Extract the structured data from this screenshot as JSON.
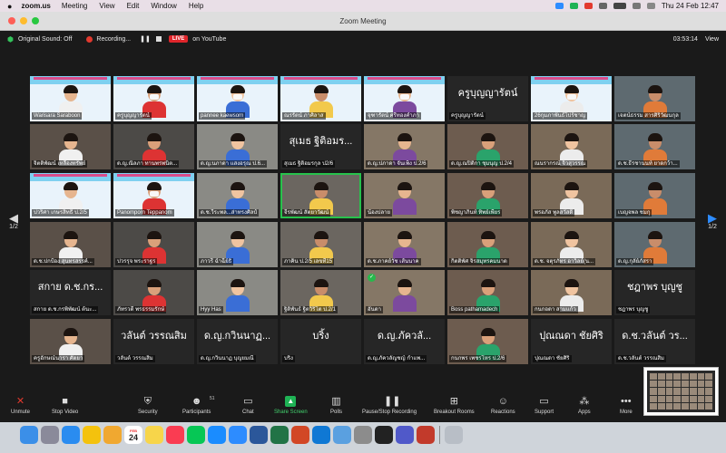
{
  "menubar": {
    "app": "zoom.us",
    "menus": [
      "Meeting",
      "View",
      "Edit",
      "Window",
      "Help"
    ],
    "datetime": "Thu 24 Feb 12:47"
  },
  "window": {
    "title": "Zoom Meeting"
  },
  "topbar": {
    "audio": "Original Sound: Off",
    "recording": "Recording...",
    "live_badge": "LIVE",
    "live_target": "on YouTube",
    "timer": "03:53:14",
    "view": "View"
  },
  "gallery": {
    "page_left": "1/2",
    "page_right": "1/2",
    "tiles": [
      {
        "kind": "banner",
        "label": "Warisara Saraboon",
        "mask": false
      },
      {
        "kind": "banner",
        "label": "ครูบุญญารัตน์",
        "mask": true
      },
      {
        "kind": "banner",
        "label": "pannee kaewsorn",
        "mask": true
      },
      {
        "kind": "banner",
        "label": "ณรรัตน์ ภาศิลาส",
        "mask": false
      },
      {
        "kind": "banner",
        "label": "จุฑารัตน์ ศรีทองคำภา",
        "mask": true
      },
      {
        "kind": "text",
        "big": "ครูบุญญารัตน์",
        "label": "ครูบุญญารัตน์"
      },
      {
        "kind": "banner",
        "label": "26กุมภาพันธ์โปร์ชาญ",
        "mask": true
      },
      {
        "kind": "video",
        "label": "เจตน์ธรรม สารศิริวัฒนกุล"
      },
      {
        "kind": "video",
        "label": "จิตติพัฒน์ เหลืองทรัพย์"
      },
      {
        "kind": "video",
        "label": "ด.ญ.ณิลภา ทานพรพนิต..."
      },
      {
        "kind": "video",
        "label": "ด.ญ.นภาดา แสงอรุณ ป.6..."
      },
      {
        "kind": "text",
        "big": "สุเมธ ฐิติอมร...",
        "label": "สุเมธ ฐิติอมรกุล ป2/6"
      },
      {
        "kind": "video",
        "label": "ด.ญ.ปภาดา จันเพ็ง ป.2/6"
      },
      {
        "kind": "video",
        "label": "ด.ญ.ณปิติกา ชุมนุญ ป.2/4"
      },
      {
        "kind": "video",
        "label": "ณนรากรณ์ จิวสุวรรณ"
      },
      {
        "kind": "video",
        "label": "ด.ช.ธีรชานนท์ ยาดกว้า..."
      },
      {
        "kind": "banner",
        "label": "ปวริศา เกษรสิทธิ์ ป.2/5",
        "mask": false
      },
      {
        "kind": "banner",
        "label": "Panomporn Teppanom",
        "mask": true
      },
      {
        "kind": "video",
        "label": "ด.ช.วีระพล...ส่าทรงศิลป์"
      },
      {
        "kind": "video",
        "label": "จีรพัฒน์ สัตยาวัฒน์",
        "talk": true
      },
      {
        "kind": "video",
        "label": "น้องปลาย"
      },
      {
        "kind": "video",
        "label": "พิชญาภินท์ ทิพย์เพียร"
      },
      {
        "kind": "video",
        "label": "พรอภัส พูลสวัสดิ์"
      },
      {
        "kind": "video",
        "label": "เบญจพล ชมกุ"
      },
      {
        "kind": "video",
        "label": "ด.ช.ปกป้อง สุนทรสรรค์..."
      },
      {
        "kind": "video",
        "label": "ปวรรุจ พระราฐร"
      },
      {
        "kind": "video",
        "label": "ภาวรี ฉำฉีย์ธิ"
      },
      {
        "kind": "video",
        "label": "ภาคิน ป.2/5 เลขที่15"
      },
      {
        "kind": "video",
        "label": "ด.ช.ภาคย์วัช เส้นนาค"
      },
      {
        "kind": "video",
        "label": "กิตติพัศ จิรสมุทรคมนาด"
      },
      {
        "kind": "video",
        "label": "ด.ช. จตุรภัทร อาวิลย์(น..."
      },
      {
        "kind": "video",
        "label": "ด.ญ.กุลัย์ภัสรา"
      },
      {
        "kind": "text",
        "big": "สกาย ด.ช.กร...",
        "label": "สกาย ด.ช.กรพิพัฒน์ ต้นะ..."
      },
      {
        "kind": "video",
        "label": "ภัทรวดี พรธรรมรักษ์"
      },
      {
        "kind": "video",
        "label": "Hyy Has"
      },
      {
        "kind": "video",
        "label": "ฐิติพันธ์ ฐิตวิริโต ป.2/1"
      },
      {
        "kind": "video",
        "label": "อันดา",
        "check": true
      },
      {
        "kind": "video",
        "label": "Boss pathamadech"
      },
      {
        "kind": "video",
        "label": "กนกอดา สามแก้ว"
      },
      {
        "kind": "text",
        "big": "ชฎาพร บุญชู",
        "label": "ชฎาพร บุญชู"
      },
      {
        "kind": "video",
        "label": "ครูอักษณ์นารา ศัตยา"
      },
      {
        "kind": "text",
        "big": "วลันต์ วรรณสิม",
        "label": "วลันต์ วรรณสิม"
      },
      {
        "kind": "text",
        "big": "ด.ญ.กวินนาฏ...",
        "label": "ด.ญ.กวินนาฏ บุญยมณี"
      },
      {
        "kind": "text",
        "big": "บริ้ง",
        "label": "บริ้ง"
      },
      {
        "kind": "text",
        "big": "ด.ญ.ภัควลั...",
        "label": "ด.ญ.ภัควลัญชญ์ กำแพ..."
      },
      {
        "kind": "video",
        "label": "กนกพร เพชรโหร ป.2/6"
      },
      {
        "kind": "text",
        "big": "ปุณณดา ชัยศิริ",
        "label": "ปุณณดา ชัยศิริ"
      },
      {
        "kind": "text",
        "big": "ด.ช.วลันต์ วร...",
        "label": "ด.ช.วลันต์ วรรณสิม"
      }
    ]
  },
  "toolbar": {
    "unmute": "Unmute",
    "stop_video": "Stop Video",
    "security": "Security",
    "participants": "Participants",
    "participants_count": "51",
    "chat": "Chat",
    "share_screen": "Share Screen",
    "polls": "Polls",
    "pause_recording": "Pause/Stop Recording",
    "breakout": "Breakout Rooms",
    "reactions": "Reactions",
    "support": "Support",
    "apps": "Apps",
    "more": "More"
  },
  "dock": {
    "calendar_month": "FEB",
    "calendar_day": "24",
    "icons": [
      "finder",
      "launchpad",
      "safari",
      "chrome",
      "photos",
      "calendar",
      "notes",
      "music",
      "line",
      "appstore",
      "zoom",
      "word",
      "excel",
      "powerpoint",
      "onedrive",
      "preview",
      "settings",
      "terminal",
      "teams",
      "photobooth",
      "trash"
    ]
  },
  "colors": {
    "live": "#e0252b",
    "share_green": "#1fb355",
    "active_speaker": "#27c24c",
    "page_arrow": "#2d8cff"
  }
}
